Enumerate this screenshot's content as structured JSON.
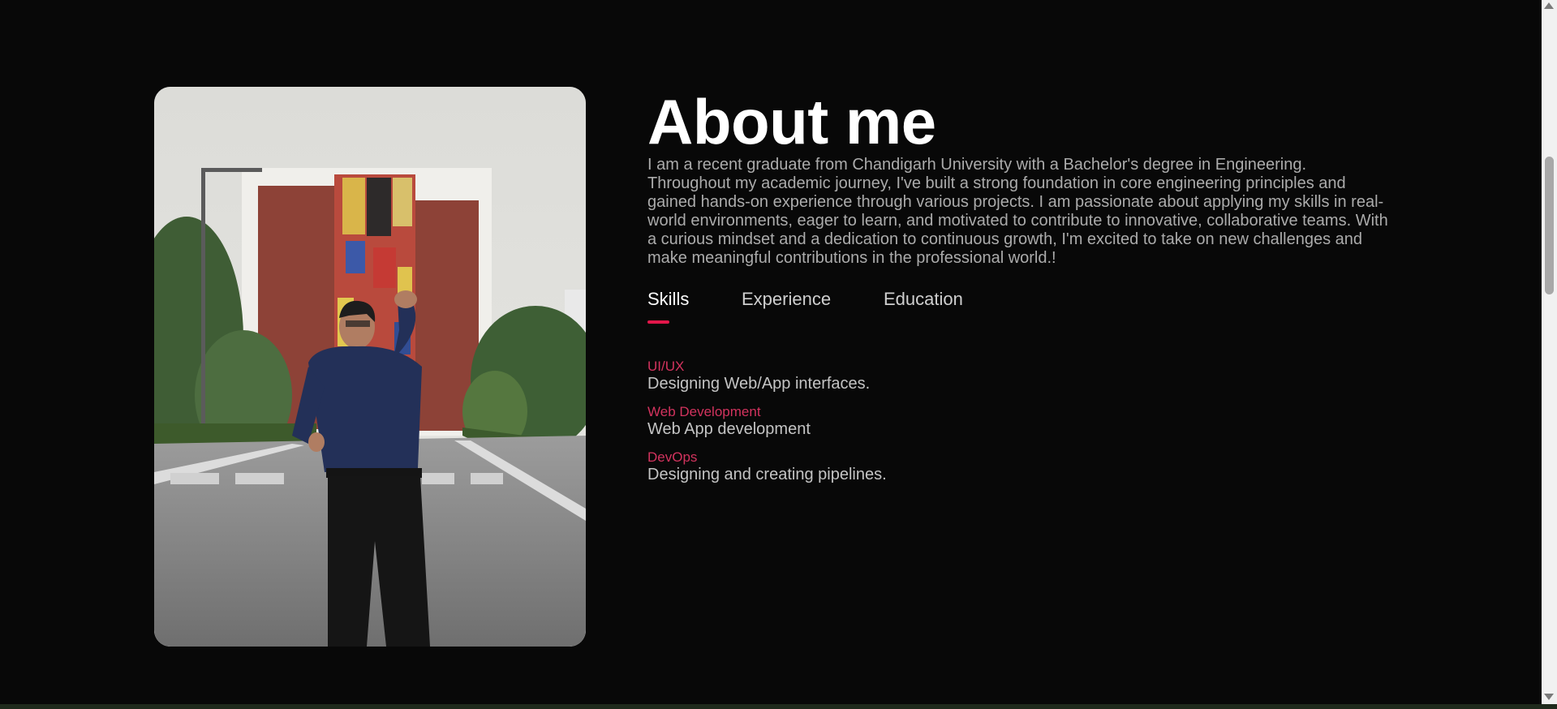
{
  "about": {
    "title": "About me",
    "bio": "I am a recent graduate from Chandigarh University with a Bachelor's degree in Engineering. Throughout my academic journey, I've built a strong foundation in core engineering principles and gained hands-on experience through various projects. I am passionate about applying my skills in real-world environments, eager to learn, and motivated to contribute to innovative, collaborative teams. With a curious mindset and a dedication to continuous growth, I'm excited to take on new challenges and make meaningful contributions in the professional world.!",
    "tabs": [
      {
        "label": "Skills"
      },
      {
        "label": "Experience"
      },
      {
        "label": "Education"
      }
    ],
    "active_tab": "Skills",
    "skills": [
      {
        "name": "UI/UX",
        "description": "Designing Web/App interfaces."
      },
      {
        "name": "Web Development",
        "description": "Web App development"
      },
      {
        "name": "DevOps",
        "description": "Designing and creating pipelines."
      }
    ]
  },
  "colors": {
    "background": "#080808",
    "accent": "#e3164a",
    "skill_name": "#d2335e",
    "body_text": "#ababab"
  },
  "icons": {
    "profile_photo": "profile-photo"
  }
}
